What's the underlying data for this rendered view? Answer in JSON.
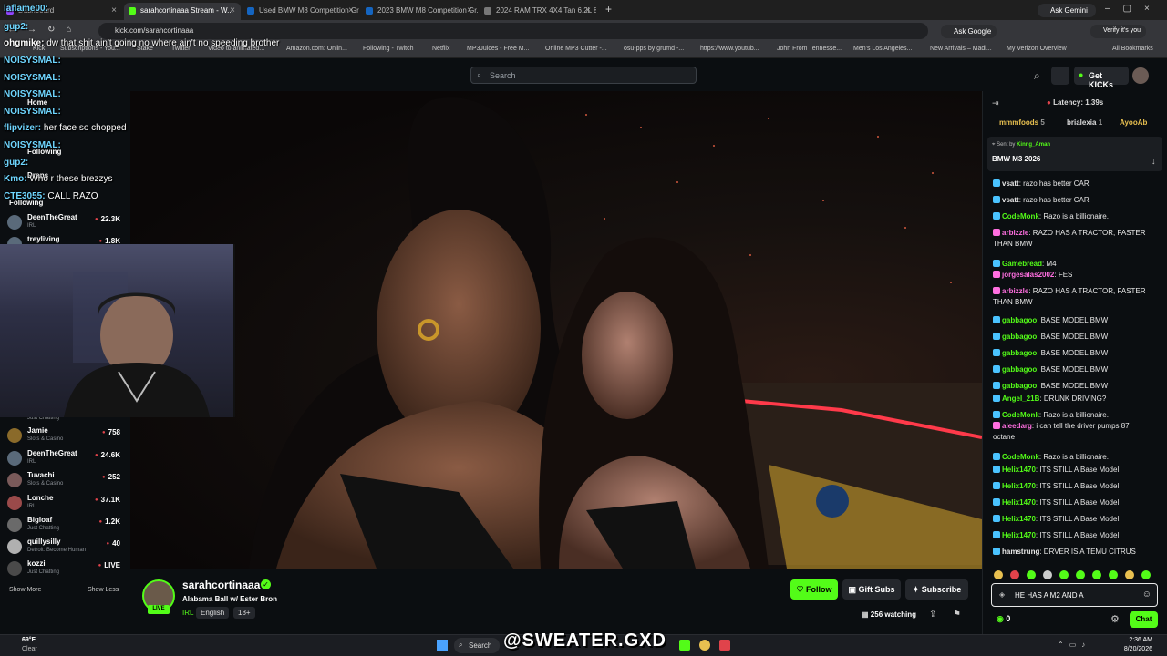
{
  "browser": {
    "tabs": [
      {
        "label": "Dashboard"
      },
      {
        "label": "sarahcortinaaa Stream - W..."
      },
      {
        "label": "Used BMW M8 Competition Gr..."
      },
      {
        "label": "2023 BMW M8 Competition Gr..."
      },
      {
        "label": "2024 RAM TRX 4X4 Tan 6.2L 8..."
      }
    ],
    "new_tab": "+",
    "ask_gemini": "Ask Gemini",
    "url": "kick.com/sarahcortinaaa",
    "ask_google": "Ask Google",
    "profile": "Verify it's you",
    "bookmarks": [
      "Kick",
      "Subscriptions - You...",
      "Stake",
      "Twitter",
      "Video to animated...",
      "Amazon.com: Onlin...",
      "Following - Twitch",
      "Netflix",
      "MP3Juices - Free M...",
      "Online MP3 Cutter -...",
      "osu-pps by grumd -...",
      "https://www.youtub...",
      "John From Tennesse...",
      "Men's Los Angeles...",
      "New Arrivals – Madi...",
      "My Verizon Overview"
    ],
    "all_bookmarks": "All Bookmarks"
  },
  "kick": {
    "search_placeholder": "Search",
    "get_kicks": "Get KICKs",
    "nav_home": "Home",
    "nav_following": "Following",
    "nav_drops": "Drops",
    "following_header": "Following",
    "show_more": "Show More",
    "show_less": "Show Less"
  },
  "sidebar": {
    "channels_top": [
      {
        "name": "DeenTheGreat",
        "category": "IRL",
        "viewers": "22.3K"
      },
      {
        "name": "treyliving",
        "category": "",
        "viewers": "1.8K"
      }
    ],
    "channels": [
      {
        "name": "",
        "category": "Just Chatting",
        "viewers": ""
      },
      {
        "name": "Jamie",
        "category": "Slots & Casino",
        "viewers": "758"
      },
      {
        "name": "DeenTheGreat",
        "category": "IRL",
        "viewers": "24.6K"
      },
      {
        "name": "Tuvachi",
        "category": "Slots & Casino",
        "viewers": "252"
      },
      {
        "name": "Lonche",
        "category": "IRL",
        "viewers": "37.1K"
      },
      {
        "name": "Bigloaf",
        "category": "Just Chatting",
        "viewers": "1.2K"
      },
      {
        "name": "quillysilly",
        "category": "Detroit: Become Human",
        "viewers": "40"
      },
      {
        "name": "kozzi",
        "category": "Just Chatting",
        "viewers": "LIVE"
      }
    ]
  },
  "overlay_chat": [
    {
      "user": "laflame00:",
      "text": ""
    },
    {
      "user": "gup2:",
      "text": ""
    },
    {
      "user": "ohgmike:",
      "text": "dw that shit ain't going no where ain't no speeding brother"
    },
    {
      "user": "NOISYSMAL:",
      "text": ""
    },
    {
      "user": "NOISYSMAL:",
      "text": ""
    },
    {
      "user": "NOISYSMAL:",
      "text": ""
    },
    {
      "user": "NOISYSMAL:",
      "text": ""
    },
    {
      "user": "flipvizer:",
      "text": "her face so chopped"
    },
    {
      "user": "NOISYSMAL:",
      "text": ""
    },
    {
      "user": "gup2:",
      "text": ""
    },
    {
      "user": "Kmo:",
      "text": "Who r these brezzys"
    },
    {
      "user": "CTE3055:",
      "text": "CALL RAZO"
    }
  ],
  "stream": {
    "channel": "sarahcortinaaa",
    "title": "Alabama Ball w/ Ester Bron",
    "tags": [
      "IRL",
      "English",
      "18+"
    ],
    "live_badge": "LIVE",
    "follow": "Follow",
    "gift_subs": "Gift Subs",
    "subscribe": "Subscribe",
    "watching": "256 watching"
  },
  "chat": {
    "latency": "Latency: 1.39s",
    "top_gifters": [
      {
        "name": "mmmfoods",
        "count": "5"
      },
      {
        "name": "brialexia",
        "count": "1"
      },
      {
        "name": "AyooAb",
        "count": ""
      }
    ],
    "pinned_sender_label": "Sent by",
    "pinned_sender": "Kinng_Aman",
    "pinned_message": "BMW M3 2026",
    "messages": [
      {
        "user": "vsatt",
        "text": "razo has better CAR",
        "color": "#e8e8e8"
      },
      {
        "user": "vsatt",
        "text": "razo has better CAR",
        "color": "#e8e8e8"
      },
      {
        "user": "CodeMonk",
        "text": "Razo is a billionaire.",
        "color": "#53fc18"
      },
      {
        "user": "arbizzle",
        "text": "RAZO HAS A TRACTOR, FASTER THAN BMW",
        "color": "#ff6fe0"
      },
      {
        "user": "Gamebread",
        "text": "M4",
        "color": "#53fc18"
      },
      {
        "user": "jorgesalas2002",
        "text": "FES",
        "color": "#ff6fe0"
      },
      {
        "user": "arbizzle",
        "text": "RAZO HAS A TRACTOR, FASTER THAN BMW",
        "color": "#ff6fe0"
      },
      {
        "user": "gabbagoo",
        "text": "BASE MODEL BMW",
        "color": "#53fc18"
      },
      {
        "user": "gabbagoo",
        "text": "BASE MODEL BMW",
        "color": "#53fc18"
      },
      {
        "user": "gabbagoo",
        "text": "BASE MODEL BMW",
        "color": "#53fc18"
      },
      {
        "user": "gabbagoo",
        "text": "BASE MODEL BMW",
        "color": "#53fc18"
      },
      {
        "user": "gabbagoo",
        "text": "BASE MODEL BMW",
        "color": "#53fc18"
      },
      {
        "user": "Angel_21B",
        "text": "DRUNK DRIVING?",
        "color": "#53fc18"
      },
      {
        "user": "CodeMonk",
        "text": "Razo is a billionaire.",
        "color": "#53fc18"
      },
      {
        "user": "aleedarg",
        "text": "i can tell the driver pumps 87 octane",
        "color": "#ff6fe0"
      },
      {
        "user": "CodeMonk",
        "text": "Razo is a billionaire.",
        "color": "#53fc18"
      },
      {
        "user": "Helix1470",
        "text": "ITS STILL A Base Model",
        "color": "#53fc18"
      },
      {
        "user": "Helix1470",
        "text": "ITS STILL A Base Model",
        "color": "#53fc18"
      },
      {
        "user": "Helix1470",
        "text": "ITS STILL A Base Model",
        "color": "#53fc18"
      },
      {
        "user": "Helix1470",
        "text": "ITS STILL A Base Model",
        "color": "#53fc18"
      },
      {
        "user": "Helix1470",
        "text": "ITS STILL A Base Model",
        "color": "#53fc18"
      },
      {
        "user": "hamstrung",
        "text": "DRVER IS A TEMU CITRUS",
        "color": "#e8e8e8"
      }
    ],
    "input_value": "HE HAS A M2 AND A",
    "kicks_count": "0",
    "chat_button": "Chat"
  },
  "taskbar": {
    "weather_temp": "69°F",
    "weather_text": "Clear",
    "search": "Search",
    "time": "2:36 AM",
    "date": "8/20/2026"
  },
  "watermark": "@SWEATER.GXD",
  "colors": {
    "kick_green": "#53fc18",
    "bg": "#0b0e11"
  }
}
